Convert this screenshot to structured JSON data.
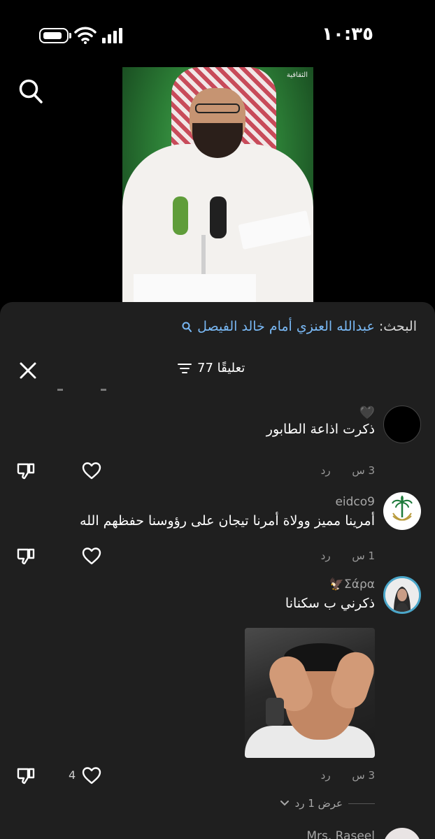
{
  "status_bar": {
    "time": "١٠:٣٥"
  },
  "search": {
    "label": "البحث:",
    "query": "عبدالله العنزي أمام خالد الفيصل"
  },
  "video": {
    "watermark": "الثقافية"
  },
  "comments_header": {
    "count_label": "77 تعليقًا"
  },
  "comments": [
    {
      "username": "",
      "heart": "🖤",
      "text": "ذكرت اذاعة الطابور",
      "time": "3 س",
      "reply": "رد",
      "likes": ""
    },
    {
      "username": "eidco9",
      "text": "أمرينا مميز وولاة أمرنا تيجان على رؤوسنا حفظهم الله",
      "time": "1 س",
      "reply": "رد",
      "likes": ""
    },
    {
      "username": "Σάρα🦅",
      "text": "ذكرني ب سكنانا",
      "time": "3 س",
      "reply": "رد",
      "likes": "4"
    }
  ],
  "view_replies": "عرض 1 رد",
  "peek": {
    "username": "Mrs. Raseel"
  },
  "colors": {
    "sheet_bg": "#1f1f1f",
    "link": "#79b8f4",
    "muted": "#9a9a9a"
  }
}
